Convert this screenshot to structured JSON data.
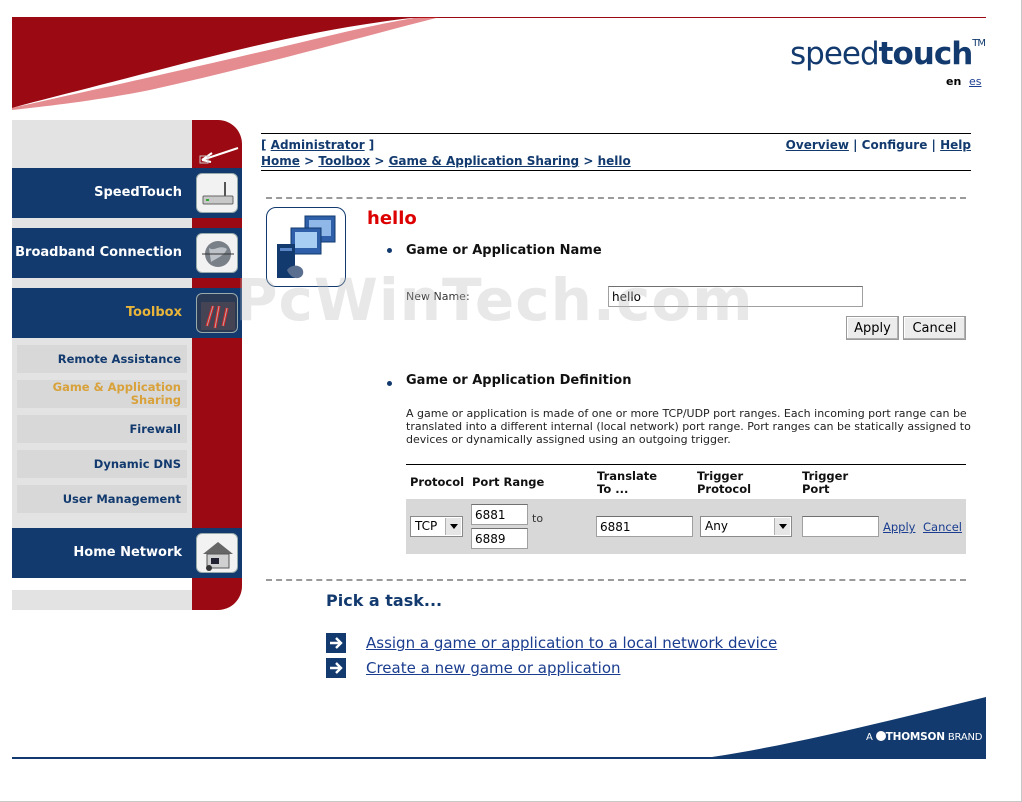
{
  "header": {
    "logo_light": "speed",
    "logo_bold": "touch",
    "logo_tm": "TM",
    "lang_current": "en",
    "lang_other": "es"
  },
  "sidebar": {
    "main_items": [
      {
        "label": "SpeedTouch",
        "icon": "router-icon"
      },
      {
        "label": "Broadband Connection",
        "icon": "globe-icon"
      },
      {
        "label": "Toolbox",
        "icon": "toolbox-icon",
        "active": true
      },
      {
        "label": "Home Network",
        "icon": "house-icon"
      }
    ],
    "sub_items": [
      {
        "label": "Remote Assistance"
      },
      {
        "label": "Game & Application Sharing",
        "active": true
      },
      {
        "label": "Firewall"
      },
      {
        "label": "Dynamic DNS"
      },
      {
        "label": "User Management"
      }
    ]
  },
  "topbar": {
    "role": "Administrator",
    "breadcrumb": [
      "Home",
      "Toolbox",
      "Game & Application Sharing",
      "hello"
    ],
    "links": [
      "Overview",
      "Configure",
      "Help"
    ]
  },
  "page": {
    "title": "hello",
    "section1_heading": "Game or Application Name",
    "new_name_label": "New Name:",
    "new_name_value": "hello",
    "apply_label": "Apply",
    "cancel_label": "Cancel",
    "section2_heading": "Game or Application Definition",
    "description": "A game or application is made of one or more TCP/UDP port ranges. Each incoming port range can be translated into a different internal (local network) port range. Port ranges can be statically assigned to devices or dynamically assigned using an outgoing trigger."
  },
  "port_table": {
    "headers": {
      "protocol": "Protocol",
      "port_range": "Port Range",
      "translate_to_1": "Translate",
      "translate_to_2": "To ...",
      "trigger_protocol_1": "Trigger",
      "trigger_protocol_2": "Protocol",
      "trigger_port_1": "Trigger",
      "trigger_port_2": "Port"
    },
    "row": {
      "protocol": "TCP",
      "range_from": "6881",
      "to_label": "to",
      "range_to": "6889",
      "translate_to": "6881",
      "trigger_protocol": "Any",
      "trigger_port": "",
      "apply": "Apply",
      "cancel": "Cancel"
    }
  },
  "tasks": {
    "heading": "Pick a task...",
    "items": [
      "Assign a game or application to a local network device",
      "Create a new game or application"
    ]
  },
  "footer": {
    "brand_prefix": "A",
    "brand_name": "THOMSON",
    "brand_suffix": "BRAND"
  },
  "watermark": "PcWinTech.com",
  "colors": {
    "navy": "#123a6e",
    "red": "#9b0a12",
    "title_red": "#dd0000",
    "active_gold": "#e8b53a"
  }
}
